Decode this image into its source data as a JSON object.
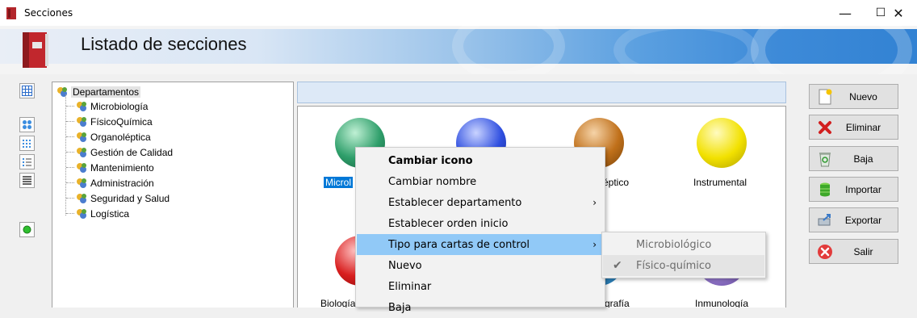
{
  "window": {
    "title": "Secciones",
    "minimize": "—",
    "maximize": "☐",
    "close": "✕"
  },
  "header": {
    "title": "Listado de secciones"
  },
  "left_toolbar": {
    "buttons": [
      {
        "icon": "grid-icon"
      },
      {
        "icon": "large-icons-view-icon"
      },
      {
        "icon": "small-icons-view-icon"
      },
      {
        "icon": "list-view-icon"
      },
      {
        "icon": "details-view-icon"
      },
      {
        "icon": "green-status-icon"
      }
    ]
  },
  "tree": {
    "root": "Departamentos",
    "children": [
      "Microbiología",
      "FísicoQuímica",
      "Organoléptica",
      "Gestión de Calidad",
      "Mantenimiento",
      "Administración",
      "Seguridad y Salud",
      "Logística"
    ]
  },
  "path_bar": {
    "text": ""
  },
  "icon_view": {
    "items": [
      {
        "label": "Microbiología",
        "visible_label": "Microl",
        "color": "#2e9e6a",
        "selected": true
      },
      {
        "label": "",
        "color": "#2f4fe0"
      },
      {
        "label": "éptico",
        "color": "#c0701a"
      },
      {
        "label": "Instrumental",
        "color": "#f2e100"
      },
      {
        "label": "Biología",
        "color": "#d81e1e"
      },
      {
        "label": "grafía",
        "color": "#3a9ad8"
      },
      {
        "label": "Inmunología",
        "color": "#9b7fd3"
      }
    ]
  },
  "context_menu": {
    "items": [
      {
        "label": "Cambiar icono",
        "bold": true
      },
      {
        "label": "Cambiar nombre"
      },
      {
        "label": "Establecer departamento",
        "submenu": true
      },
      {
        "label": "Establecer orden inicio"
      },
      {
        "label": "Tipo para cartas de control",
        "submenu": true,
        "highlighted": true
      },
      {
        "label": "Nuevo"
      },
      {
        "label": "Eliminar"
      },
      {
        "label": "Baja"
      }
    ],
    "arrow": "›"
  },
  "submenu": {
    "items": [
      {
        "label": "Microbiológico",
        "checked": false
      },
      {
        "label": "Físico-químico",
        "checked": true
      }
    ],
    "check": "✔"
  },
  "right_buttons": [
    {
      "label": "Nuevo",
      "icon": "new-document-icon"
    },
    {
      "label": "Eliminar",
      "icon": "red-x-icon"
    },
    {
      "label": "Baja",
      "icon": "recycle-bin-icon"
    },
    {
      "label": "Importar",
      "icon": "import-database-icon"
    },
    {
      "label": "Exportar",
      "icon": "export-icon"
    },
    {
      "label": "Salir",
      "icon": "exit-icon"
    }
  ],
  "colors": {
    "menu_highlight": "#91c9f7",
    "path_bar": "#dde9f7",
    "selection": "#0078d7"
  }
}
